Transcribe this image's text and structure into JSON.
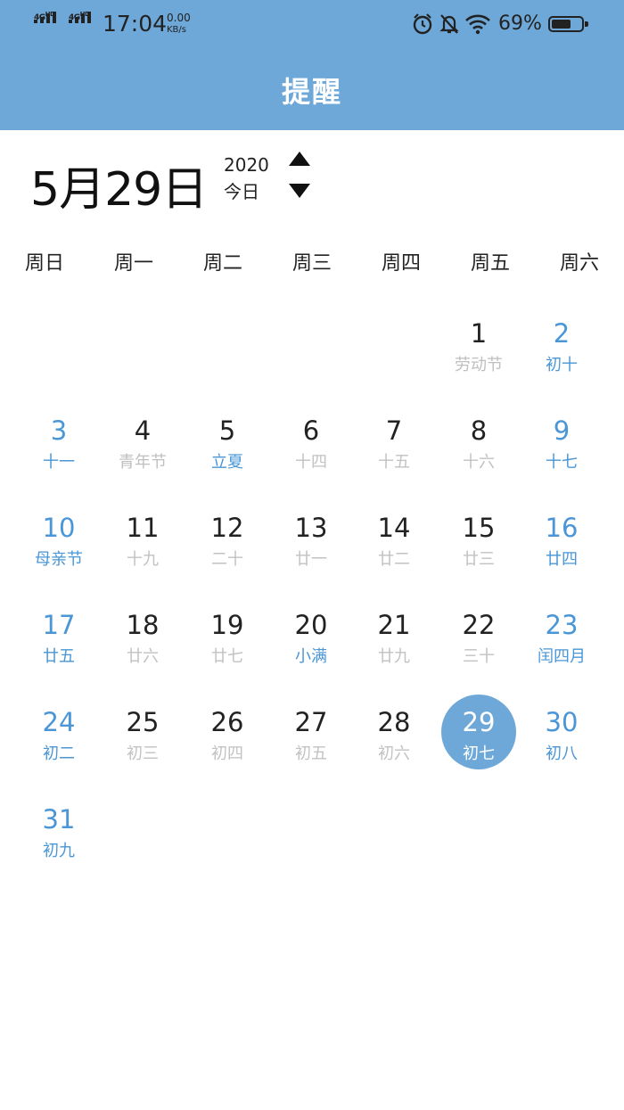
{
  "status_bar": {
    "network_1": "4G",
    "network_1_badge": "HD",
    "network_2": "4G",
    "network_2_badge": "HD",
    "time": "17:04",
    "speed_value": "0.00",
    "speed_unit": "KB/s",
    "icons": [
      "alarm-icon",
      "mute-icon",
      "wifi-icon"
    ],
    "battery_percent": "69%",
    "battery_level": 0.69
  },
  "header": {
    "title": "提醒",
    "color": "#6ea8d8"
  },
  "date_display": {
    "big": "5月29日",
    "year": "2020",
    "today_label": "今日"
  },
  "weekdays": [
    "周日",
    "周一",
    "周二",
    "周三",
    "周四",
    "周五",
    "周六"
  ],
  "calendar": {
    "first_weekday": 5,
    "selected_day": 29,
    "accent": "#4a96d6",
    "days": [
      {
        "day": "1",
        "lunar": "劳动节",
        "type": "holiday"
      },
      {
        "day": "2",
        "lunar": "初十"
      },
      {
        "day": "3",
        "lunar": "十一"
      },
      {
        "day": "4",
        "lunar": "青年节",
        "type": "holiday"
      },
      {
        "day": "5",
        "lunar": "立夏",
        "type": "festival"
      },
      {
        "day": "6",
        "lunar": "十四"
      },
      {
        "day": "7",
        "lunar": "十五"
      },
      {
        "day": "8",
        "lunar": "十六"
      },
      {
        "day": "9",
        "lunar": "十七"
      },
      {
        "day": "10",
        "lunar": "母亲节"
      },
      {
        "day": "11",
        "lunar": "十九"
      },
      {
        "day": "12",
        "lunar": "二十"
      },
      {
        "day": "13",
        "lunar": "廿一"
      },
      {
        "day": "14",
        "lunar": "廿二"
      },
      {
        "day": "15",
        "lunar": "廿三"
      },
      {
        "day": "16",
        "lunar": "廿四"
      },
      {
        "day": "17",
        "lunar": "廿五"
      },
      {
        "day": "18",
        "lunar": "廿六"
      },
      {
        "day": "19",
        "lunar": "廿七"
      },
      {
        "day": "20",
        "lunar": "小满",
        "type": "festival"
      },
      {
        "day": "21",
        "lunar": "廿九"
      },
      {
        "day": "22",
        "lunar": "三十"
      },
      {
        "day": "23",
        "lunar": "闰四月"
      },
      {
        "day": "24",
        "lunar": "初二"
      },
      {
        "day": "25",
        "lunar": "初三"
      },
      {
        "day": "26",
        "lunar": "初四"
      },
      {
        "day": "27",
        "lunar": "初五"
      },
      {
        "day": "28",
        "lunar": "初六"
      },
      {
        "day": "29",
        "lunar": "初七"
      },
      {
        "day": "30",
        "lunar": "初八"
      },
      {
        "day": "31",
        "lunar": "初九"
      }
    ]
  }
}
